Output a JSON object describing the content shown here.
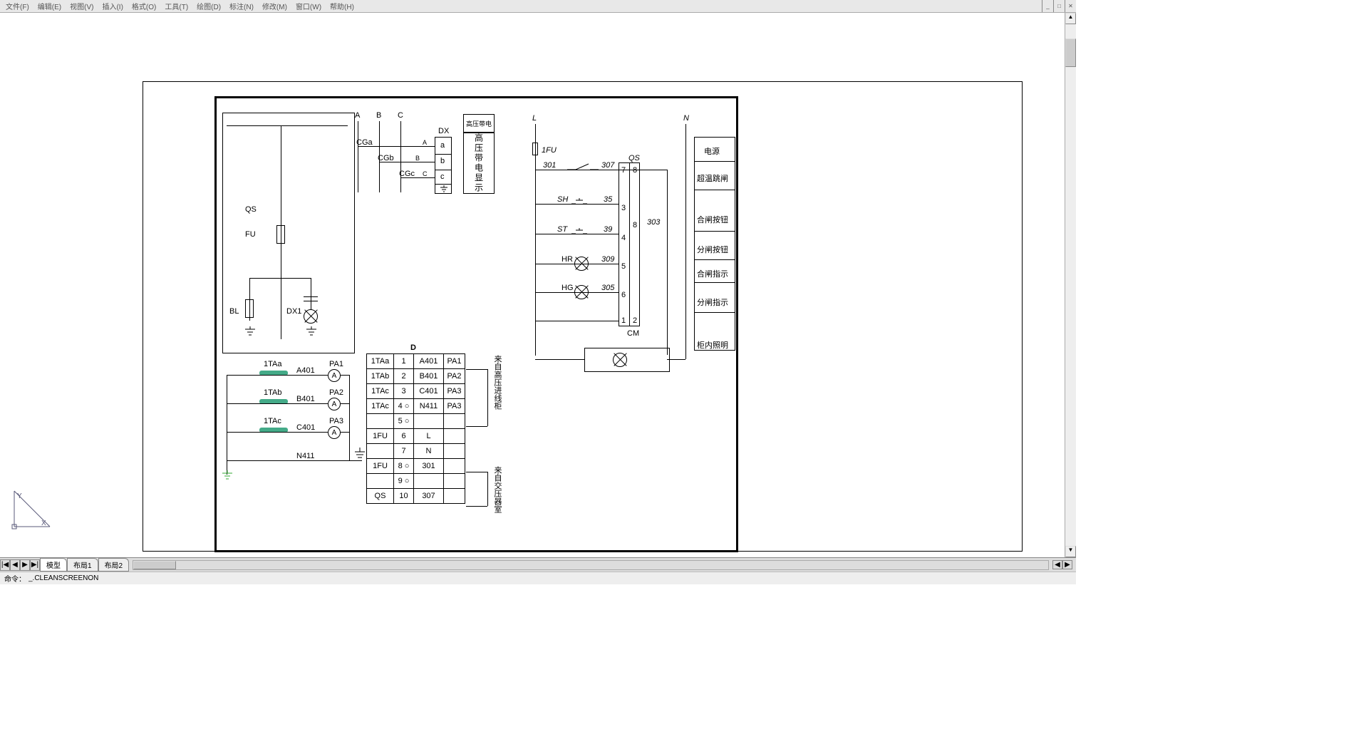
{
  "menu": {
    "file": "文件(F)",
    "edit": "编辑(E)",
    "view": "视图(V)",
    "insert": "插入(I)",
    "format": "格式(O)",
    "tools": "工具(T)",
    "draw": "绘图(D)",
    "dimension": "标注(N)",
    "modify": "修改(M)",
    "window": "窗口(W)",
    "help": "帮助(H)"
  },
  "winctl": {
    "min": "_",
    "max": "□",
    "close": "✕"
  },
  "tabs": {
    "model": "模型",
    "layout1": "布局1",
    "layout2": "布局2"
  },
  "tabnav": {
    "first": "|◀",
    "prev": "◀",
    "next": "▶",
    "last": "▶|"
  },
  "cmd": {
    "prompt": "命令：",
    "text": "_.CLEANSCREENON"
  },
  "ucs": {
    "x": "X",
    "y": "Y"
  },
  "phases": {
    "A": "A",
    "B": "B",
    "C": "C"
  },
  "dx": {
    "label": "DX",
    "a": "a",
    "b": "b",
    "c": "c",
    "A": "A",
    "B": "B",
    "C": "C",
    "cga": "CGa",
    "cgb": "CGb",
    "cgc": "CGc"
  },
  "hv": {
    "title": "高压带电",
    "body": "高压带电显示"
  },
  "leftblk": {
    "qs": "QS",
    "fu": "FU",
    "bl": "BL",
    "dx1": "DX1"
  },
  "ct": {
    "taa": "1TAa",
    "tab": "1TAb",
    "tac": "1TAc",
    "a401": "A401",
    "b401": "B401",
    "c401": "C401",
    "n411": "N411",
    "pa1": "PA1",
    "pa2": "PA2",
    "pa3": "PA3",
    "amp": "A"
  },
  "tblD": {
    "title": "D",
    "rows": [
      [
        "1TAa",
        "1",
        "A401",
        "PA1"
      ],
      [
        "1TAb",
        "2",
        "B401",
        "PA2"
      ],
      [
        "1TAc",
        "3",
        "C401",
        "PA3"
      ],
      [
        "1TAc",
        "4 ○",
        "N411",
        "PA3"
      ],
      [
        "",
        "5 ○",
        "",
        ""
      ],
      [
        "1FU",
        "6",
        "L",
        ""
      ],
      [
        "",
        "7",
        "N",
        ""
      ],
      [
        "1FU",
        "8 ○",
        "301",
        ""
      ],
      [
        "",
        "9 ○",
        "",
        ""
      ],
      [
        "QS",
        "10",
        "307",
        ""
      ]
    ]
  },
  "vnotes": {
    "upper": "来自高压进线柜",
    "lower": "来自交压器室"
  },
  "right": {
    "L": "L",
    "N": "N",
    "fu1": "1FU",
    "n301": "301",
    "n307": "307",
    "n303": "303",
    "qs": "QS",
    "sh": "SH",
    "st": "ST",
    "n35": "35",
    "n39": "39",
    "hr": "HR",
    "hg": "HG",
    "n309": "309",
    "n305": "305",
    "cm": "CM",
    "t1": "1",
    "t2": "2",
    "t3": "3",
    "t4": "4",
    "t5": "5",
    "t6": "6",
    "t7": "7",
    "t8": "8",
    "t88": "8"
  },
  "panel": [
    "电源",
    "超温跳闸",
    "合闸按钮",
    "分闸按钮",
    "合闸指示",
    "分闸指示",
    "柜内照明"
  ]
}
